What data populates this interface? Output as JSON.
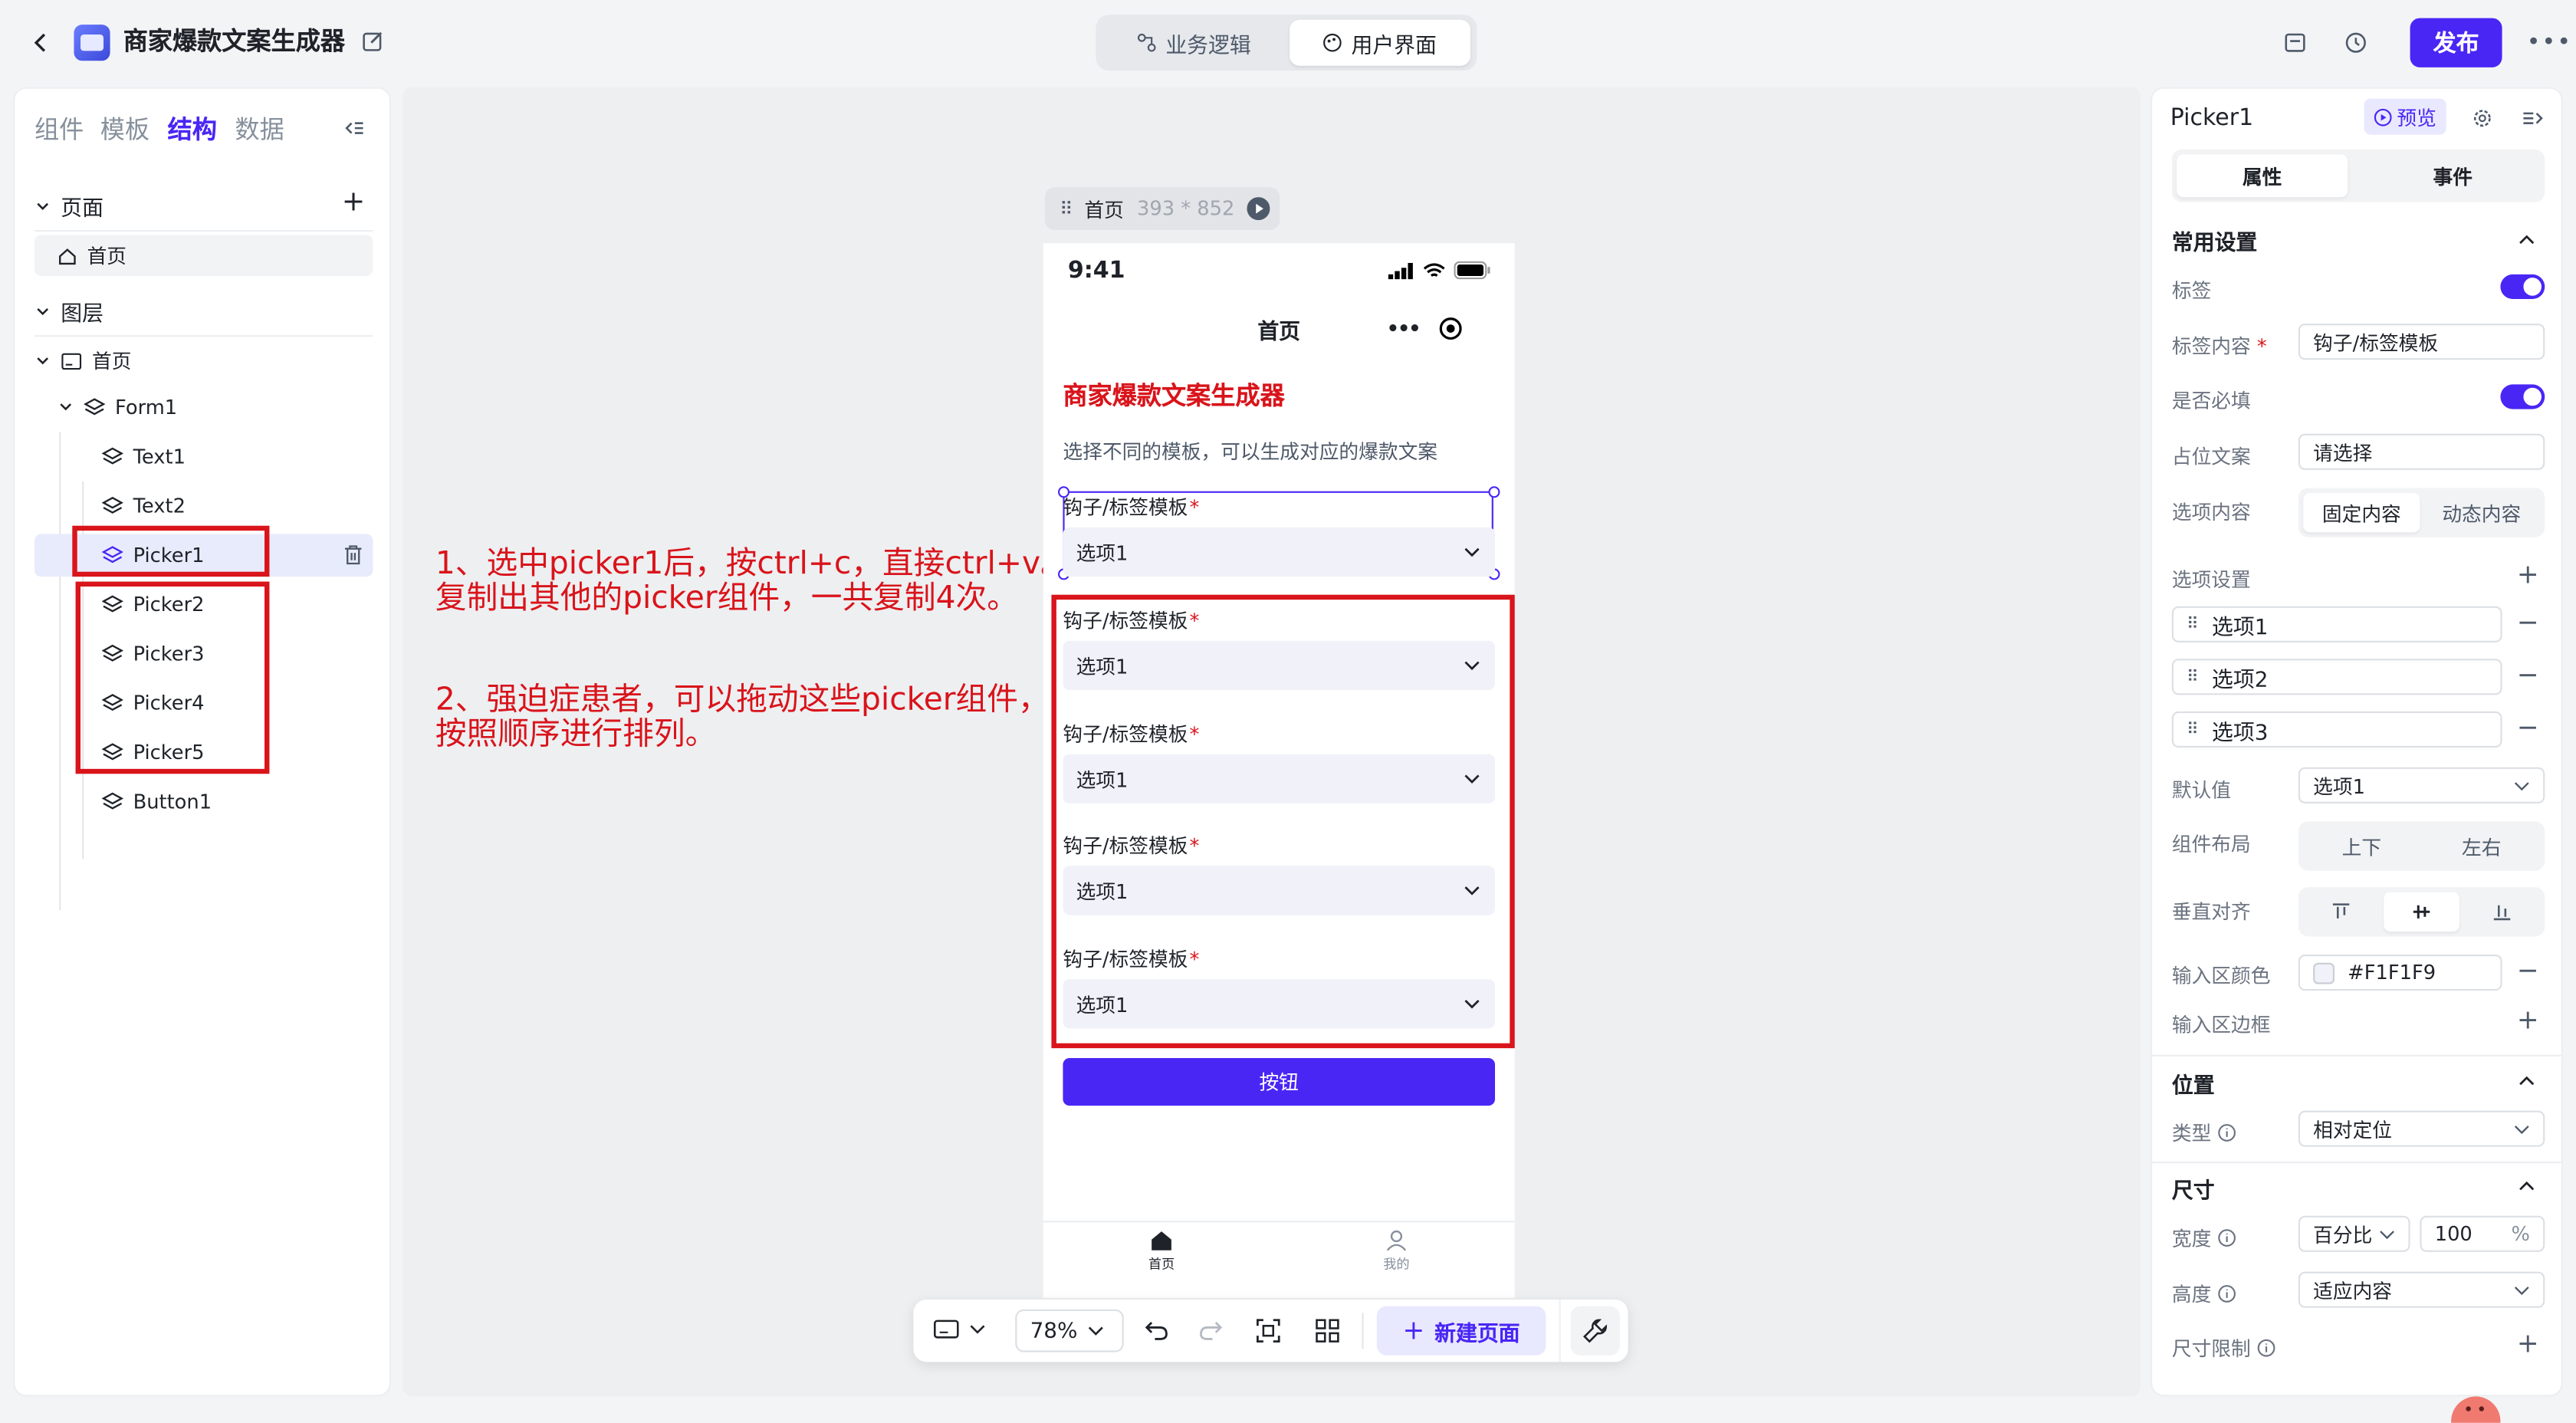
{
  "header": {
    "title": "商家爆款文案生成器",
    "tabs": [
      "业务逻辑",
      "用户界面"
    ],
    "publish_label": "发布"
  },
  "left_panel": {
    "tabs": [
      "组件",
      "模板",
      "结构",
      "数据"
    ],
    "pages_title": "页面",
    "pages": [
      "首页"
    ],
    "layers_title": "图层",
    "layers": {
      "root": "首页",
      "form": "Form1",
      "children": [
        "Text1",
        "Text2",
        "Picker1",
        "Picker2",
        "Picker3",
        "Picker4",
        "Picker5",
        "Button1"
      ]
    }
  },
  "canvas": {
    "frame_name": "首页",
    "frame_size": "393 * 852",
    "annotation_1": "1、选中picker1后，按ctrl+c，直接ctrl+v。\n复制出其他的picker组件，一共复制4次。",
    "annotation_2": "2、强迫症患者，可以拖动这些picker组件，\n按照顺序进行排列。"
  },
  "phone": {
    "time": "9:41",
    "nav_title": "首页",
    "heading": "商家爆款文案生成器",
    "subtitle": "选择不同的模板，可以生成对应的爆款文案",
    "pickers": [
      {
        "label": "钩子/标签模板",
        "value": "选项1"
      },
      {
        "label": "钩子/标签模板",
        "value": "选项1"
      },
      {
        "label": "钩子/标签模板",
        "value": "选项1"
      },
      {
        "label": "钩子/标签模板",
        "value": "选项1"
      },
      {
        "label": "钩子/标签模板",
        "value": "选项1"
      }
    ],
    "button_label": "按钮",
    "tabbar": [
      "首页",
      "我的"
    ]
  },
  "toolbar": {
    "zoom": "78%",
    "new_page_label": "新建页面"
  },
  "right_panel": {
    "component_name": "Picker1",
    "preview_label": "预览",
    "tabs": [
      "属性",
      "事件"
    ],
    "common_title": "常用设置",
    "label_label": "标签",
    "label_content_label": "标签内容",
    "label_content_value": "钩子/标签模板",
    "required_label": "是否必填",
    "placeholder_label": "占位文案",
    "placeholder_value": "请选择",
    "options_content_label": "选项内容",
    "options_content_tabs": [
      "固定内容",
      "动态内容"
    ],
    "options_settings_label": "选项设置",
    "options": [
      "选项1",
      "选项2",
      "选项3"
    ],
    "default_label": "默认值",
    "default_value": "选项1",
    "layout_label": "组件布局",
    "layout_tabs": [
      "上下",
      "左右"
    ],
    "valign_label": "垂直对齐",
    "input_color_label": "输入区颜色",
    "input_color_value": "#F1F1F9",
    "input_border_label": "输入区边框",
    "position_title": "位置",
    "type_label": "类型",
    "type_value": "相对定位",
    "size_title": "尺寸",
    "width_label": "宽度",
    "width_unit": "百分比",
    "width_value": "100",
    "width_suffix": "%",
    "height_label": "高度",
    "height_value": "适应内容",
    "size_limit_label": "尺寸限制"
  },
  "colors": {
    "accent": "#4a26f5",
    "annotation_red": "#d9141b",
    "picker_bg": "#f1f1f9"
  }
}
